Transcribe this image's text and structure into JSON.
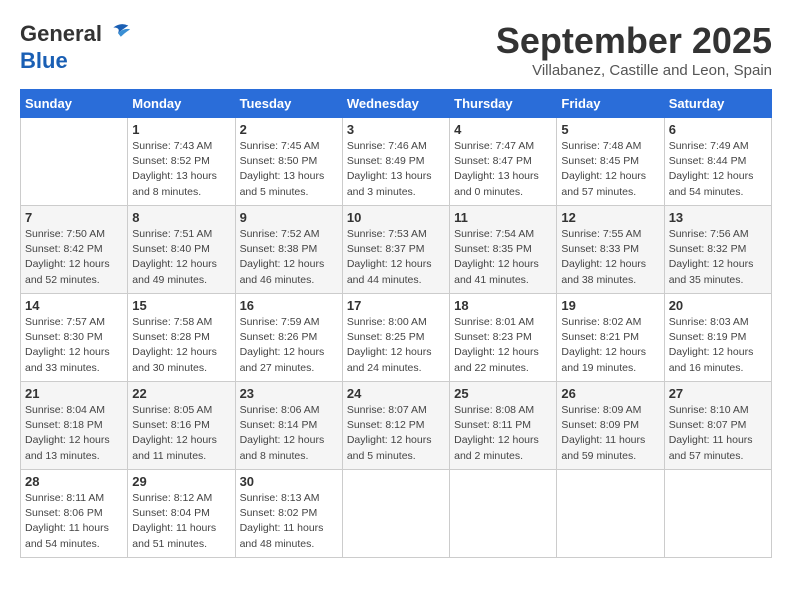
{
  "header": {
    "logo_line1": "General",
    "logo_line2": "Blue",
    "month_title": "September 2025",
    "location": "Villabanez, Castille and Leon, Spain"
  },
  "weekdays": [
    "Sunday",
    "Monday",
    "Tuesday",
    "Wednesday",
    "Thursday",
    "Friday",
    "Saturday"
  ],
  "weeks": [
    [
      null,
      {
        "day": "1",
        "sunrise": "Sunrise: 7:43 AM",
        "sunset": "Sunset: 8:52 PM",
        "daylight": "Daylight: 13 hours and 8 minutes."
      },
      {
        "day": "2",
        "sunrise": "Sunrise: 7:45 AM",
        "sunset": "Sunset: 8:50 PM",
        "daylight": "Daylight: 13 hours and 5 minutes."
      },
      {
        "day": "3",
        "sunrise": "Sunrise: 7:46 AM",
        "sunset": "Sunset: 8:49 PM",
        "daylight": "Daylight: 13 hours and 3 minutes."
      },
      {
        "day": "4",
        "sunrise": "Sunrise: 7:47 AM",
        "sunset": "Sunset: 8:47 PM",
        "daylight": "Daylight: 13 hours and 0 minutes."
      },
      {
        "day": "5",
        "sunrise": "Sunrise: 7:48 AM",
        "sunset": "Sunset: 8:45 PM",
        "daylight": "Daylight: 12 hours and 57 minutes."
      },
      {
        "day": "6",
        "sunrise": "Sunrise: 7:49 AM",
        "sunset": "Sunset: 8:44 PM",
        "daylight": "Daylight: 12 hours and 54 minutes."
      }
    ],
    [
      {
        "day": "7",
        "sunrise": "Sunrise: 7:50 AM",
        "sunset": "Sunset: 8:42 PM",
        "daylight": "Daylight: 12 hours and 52 minutes."
      },
      {
        "day": "8",
        "sunrise": "Sunrise: 7:51 AM",
        "sunset": "Sunset: 8:40 PM",
        "daylight": "Daylight: 12 hours and 49 minutes."
      },
      {
        "day": "9",
        "sunrise": "Sunrise: 7:52 AM",
        "sunset": "Sunset: 8:38 PM",
        "daylight": "Daylight: 12 hours and 46 minutes."
      },
      {
        "day": "10",
        "sunrise": "Sunrise: 7:53 AM",
        "sunset": "Sunset: 8:37 PM",
        "daylight": "Daylight: 12 hours and 44 minutes."
      },
      {
        "day": "11",
        "sunrise": "Sunrise: 7:54 AM",
        "sunset": "Sunset: 8:35 PM",
        "daylight": "Daylight: 12 hours and 41 minutes."
      },
      {
        "day": "12",
        "sunrise": "Sunrise: 7:55 AM",
        "sunset": "Sunset: 8:33 PM",
        "daylight": "Daylight: 12 hours and 38 minutes."
      },
      {
        "day": "13",
        "sunrise": "Sunrise: 7:56 AM",
        "sunset": "Sunset: 8:32 PM",
        "daylight": "Daylight: 12 hours and 35 minutes."
      }
    ],
    [
      {
        "day": "14",
        "sunrise": "Sunrise: 7:57 AM",
        "sunset": "Sunset: 8:30 PM",
        "daylight": "Daylight: 12 hours and 33 minutes."
      },
      {
        "day": "15",
        "sunrise": "Sunrise: 7:58 AM",
        "sunset": "Sunset: 8:28 PM",
        "daylight": "Daylight: 12 hours and 30 minutes."
      },
      {
        "day": "16",
        "sunrise": "Sunrise: 7:59 AM",
        "sunset": "Sunset: 8:26 PM",
        "daylight": "Daylight: 12 hours and 27 minutes."
      },
      {
        "day": "17",
        "sunrise": "Sunrise: 8:00 AM",
        "sunset": "Sunset: 8:25 PM",
        "daylight": "Daylight: 12 hours and 24 minutes."
      },
      {
        "day": "18",
        "sunrise": "Sunrise: 8:01 AM",
        "sunset": "Sunset: 8:23 PM",
        "daylight": "Daylight: 12 hours and 22 minutes."
      },
      {
        "day": "19",
        "sunrise": "Sunrise: 8:02 AM",
        "sunset": "Sunset: 8:21 PM",
        "daylight": "Daylight: 12 hours and 19 minutes."
      },
      {
        "day": "20",
        "sunrise": "Sunrise: 8:03 AM",
        "sunset": "Sunset: 8:19 PM",
        "daylight": "Daylight: 12 hours and 16 minutes."
      }
    ],
    [
      {
        "day": "21",
        "sunrise": "Sunrise: 8:04 AM",
        "sunset": "Sunset: 8:18 PM",
        "daylight": "Daylight: 12 hours and 13 minutes."
      },
      {
        "day": "22",
        "sunrise": "Sunrise: 8:05 AM",
        "sunset": "Sunset: 8:16 PM",
        "daylight": "Daylight: 12 hours and 11 minutes."
      },
      {
        "day": "23",
        "sunrise": "Sunrise: 8:06 AM",
        "sunset": "Sunset: 8:14 PM",
        "daylight": "Daylight: 12 hours and 8 minutes."
      },
      {
        "day": "24",
        "sunrise": "Sunrise: 8:07 AM",
        "sunset": "Sunset: 8:12 PM",
        "daylight": "Daylight: 12 hours and 5 minutes."
      },
      {
        "day": "25",
        "sunrise": "Sunrise: 8:08 AM",
        "sunset": "Sunset: 8:11 PM",
        "daylight": "Daylight: 12 hours and 2 minutes."
      },
      {
        "day": "26",
        "sunrise": "Sunrise: 8:09 AM",
        "sunset": "Sunset: 8:09 PM",
        "daylight": "Daylight: 11 hours and 59 minutes."
      },
      {
        "day": "27",
        "sunrise": "Sunrise: 8:10 AM",
        "sunset": "Sunset: 8:07 PM",
        "daylight": "Daylight: 11 hours and 57 minutes."
      }
    ],
    [
      {
        "day": "28",
        "sunrise": "Sunrise: 8:11 AM",
        "sunset": "Sunset: 8:06 PM",
        "daylight": "Daylight: 11 hours and 54 minutes."
      },
      {
        "day": "29",
        "sunrise": "Sunrise: 8:12 AM",
        "sunset": "Sunset: 8:04 PM",
        "daylight": "Daylight: 11 hours and 51 minutes."
      },
      {
        "day": "30",
        "sunrise": "Sunrise: 8:13 AM",
        "sunset": "Sunset: 8:02 PM",
        "daylight": "Daylight: 11 hours and 48 minutes."
      },
      null,
      null,
      null,
      null
    ]
  ]
}
